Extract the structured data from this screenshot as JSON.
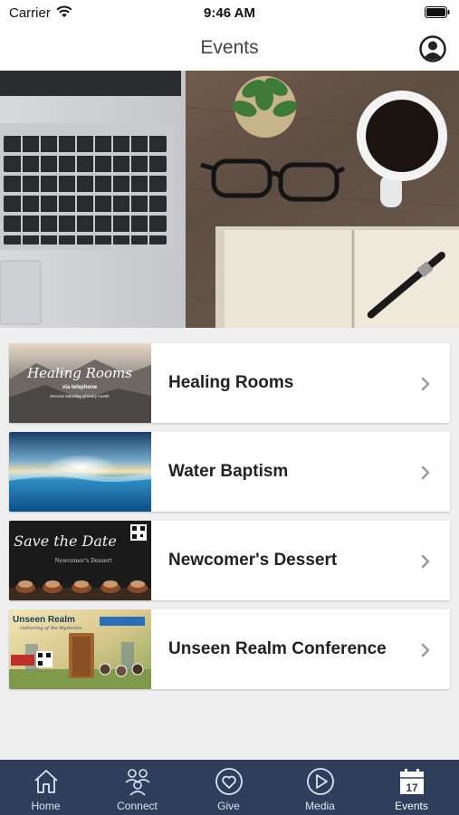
{
  "status": {
    "carrier": "Carrier",
    "time": "9:46 AM"
  },
  "nav": {
    "title": "Events"
  },
  "events": [
    {
      "title": "Healing Rooms",
      "thumb_title": "Healing Rooms",
      "thumb_sub": "via telephone",
      "thumb_detail": "Second Saturday of every month"
    },
    {
      "title": "Water Baptism"
    },
    {
      "title": "Newcomer's Dessert",
      "thumb_title": "Save the Date",
      "thumb_sub": "Newcomer's Dessert"
    },
    {
      "title": "Unseen Realm Conference",
      "thumb_title": "Unseen Realm",
      "thumb_sub": "Gathering of the Mysteries"
    }
  ],
  "tabs": [
    {
      "label": "Home",
      "icon": "house-icon"
    },
    {
      "label": "Connect",
      "icon": "people-icon"
    },
    {
      "label": "Give",
      "icon": "heart-icon"
    },
    {
      "label": "Media",
      "icon": "play-icon"
    },
    {
      "label": "Events",
      "icon": "calendar-icon",
      "calendar_day": "17"
    }
  ],
  "colors": {
    "tab_bar": "#2f3e5c",
    "background": "#efefef"
  }
}
